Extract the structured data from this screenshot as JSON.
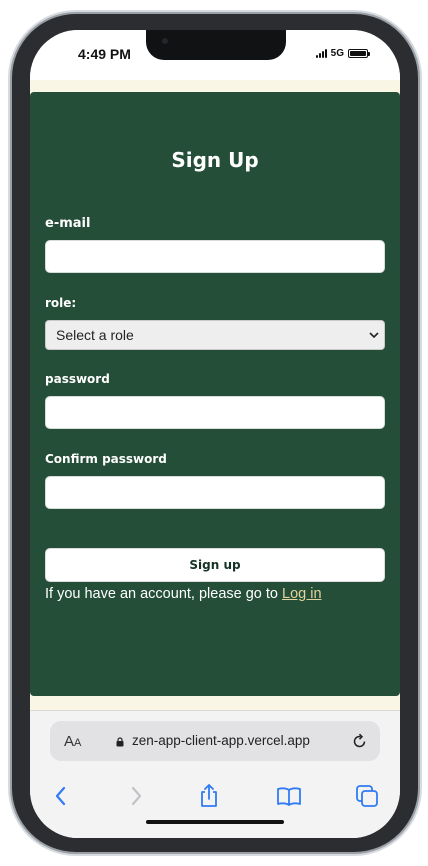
{
  "status_bar": {
    "time": "4:49 PM",
    "network": "5G"
  },
  "form": {
    "title": "Sign Up",
    "email_label": "e-mail",
    "email_value": "",
    "role_label": "role:",
    "role_selected": "Select a role",
    "password_label": "password",
    "password_value": "",
    "confirm_label": "Confirm password",
    "confirm_value": "",
    "submit_label": "Sign up",
    "account_prompt": "If you have an account, please go to ",
    "login_link": "Log in"
  },
  "browser": {
    "text_size_label": "A",
    "text_size_label_small": "A",
    "url": "zen-app-client-app.vercel.app",
    "icons": [
      "back-icon",
      "forward-icon",
      "share-icon",
      "bookmarks-icon",
      "tabs-icon"
    ]
  },
  "colors": {
    "card": "#244e38",
    "page": "#faf6e6",
    "link": "#e3d39c"
  }
}
